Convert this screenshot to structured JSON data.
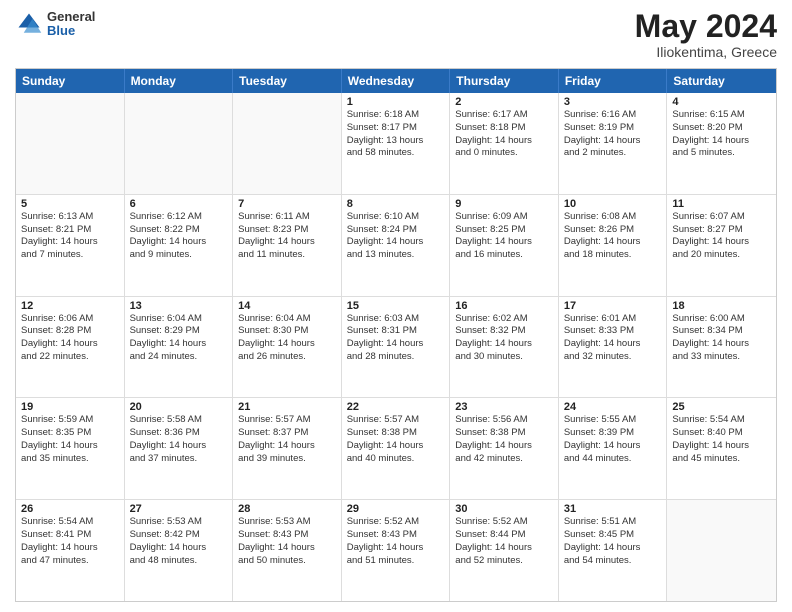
{
  "header": {
    "logo_general": "General",
    "logo_blue": "Blue",
    "title": "May 2024",
    "location": "Iliokentima, Greece"
  },
  "weekdays": [
    "Sunday",
    "Monday",
    "Tuesday",
    "Wednesday",
    "Thursday",
    "Friday",
    "Saturday"
  ],
  "weeks": [
    [
      {
        "day": "",
        "info": ""
      },
      {
        "day": "",
        "info": ""
      },
      {
        "day": "",
        "info": ""
      },
      {
        "day": "1",
        "info": "Sunrise: 6:18 AM\nSunset: 8:17 PM\nDaylight: 13 hours\nand 58 minutes."
      },
      {
        "day": "2",
        "info": "Sunrise: 6:17 AM\nSunset: 8:18 PM\nDaylight: 14 hours\nand 0 minutes."
      },
      {
        "day": "3",
        "info": "Sunrise: 6:16 AM\nSunset: 8:19 PM\nDaylight: 14 hours\nand 2 minutes."
      },
      {
        "day": "4",
        "info": "Sunrise: 6:15 AM\nSunset: 8:20 PM\nDaylight: 14 hours\nand 5 minutes."
      }
    ],
    [
      {
        "day": "5",
        "info": "Sunrise: 6:13 AM\nSunset: 8:21 PM\nDaylight: 14 hours\nand 7 minutes."
      },
      {
        "day": "6",
        "info": "Sunrise: 6:12 AM\nSunset: 8:22 PM\nDaylight: 14 hours\nand 9 minutes."
      },
      {
        "day": "7",
        "info": "Sunrise: 6:11 AM\nSunset: 8:23 PM\nDaylight: 14 hours\nand 11 minutes."
      },
      {
        "day": "8",
        "info": "Sunrise: 6:10 AM\nSunset: 8:24 PM\nDaylight: 14 hours\nand 13 minutes."
      },
      {
        "day": "9",
        "info": "Sunrise: 6:09 AM\nSunset: 8:25 PM\nDaylight: 14 hours\nand 16 minutes."
      },
      {
        "day": "10",
        "info": "Sunrise: 6:08 AM\nSunset: 8:26 PM\nDaylight: 14 hours\nand 18 minutes."
      },
      {
        "day": "11",
        "info": "Sunrise: 6:07 AM\nSunset: 8:27 PM\nDaylight: 14 hours\nand 20 minutes."
      }
    ],
    [
      {
        "day": "12",
        "info": "Sunrise: 6:06 AM\nSunset: 8:28 PM\nDaylight: 14 hours\nand 22 minutes."
      },
      {
        "day": "13",
        "info": "Sunrise: 6:04 AM\nSunset: 8:29 PM\nDaylight: 14 hours\nand 24 minutes."
      },
      {
        "day": "14",
        "info": "Sunrise: 6:04 AM\nSunset: 8:30 PM\nDaylight: 14 hours\nand 26 minutes."
      },
      {
        "day": "15",
        "info": "Sunrise: 6:03 AM\nSunset: 8:31 PM\nDaylight: 14 hours\nand 28 minutes."
      },
      {
        "day": "16",
        "info": "Sunrise: 6:02 AM\nSunset: 8:32 PM\nDaylight: 14 hours\nand 30 minutes."
      },
      {
        "day": "17",
        "info": "Sunrise: 6:01 AM\nSunset: 8:33 PM\nDaylight: 14 hours\nand 32 minutes."
      },
      {
        "day": "18",
        "info": "Sunrise: 6:00 AM\nSunset: 8:34 PM\nDaylight: 14 hours\nand 33 minutes."
      }
    ],
    [
      {
        "day": "19",
        "info": "Sunrise: 5:59 AM\nSunset: 8:35 PM\nDaylight: 14 hours\nand 35 minutes."
      },
      {
        "day": "20",
        "info": "Sunrise: 5:58 AM\nSunset: 8:36 PM\nDaylight: 14 hours\nand 37 minutes."
      },
      {
        "day": "21",
        "info": "Sunrise: 5:57 AM\nSunset: 8:37 PM\nDaylight: 14 hours\nand 39 minutes."
      },
      {
        "day": "22",
        "info": "Sunrise: 5:57 AM\nSunset: 8:38 PM\nDaylight: 14 hours\nand 40 minutes."
      },
      {
        "day": "23",
        "info": "Sunrise: 5:56 AM\nSunset: 8:38 PM\nDaylight: 14 hours\nand 42 minutes."
      },
      {
        "day": "24",
        "info": "Sunrise: 5:55 AM\nSunset: 8:39 PM\nDaylight: 14 hours\nand 44 minutes."
      },
      {
        "day": "25",
        "info": "Sunrise: 5:54 AM\nSunset: 8:40 PM\nDaylight: 14 hours\nand 45 minutes."
      }
    ],
    [
      {
        "day": "26",
        "info": "Sunrise: 5:54 AM\nSunset: 8:41 PM\nDaylight: 14 hours\nand 47 minutes."
      },
      {
        "day": "27",
        "info": "Sunrise: 5:53 AM\nSunset: 8:42 PM\nDaylight: 14 hours\nand 48 minutes."
      },
      {
        "day": "28",
        "info": "Sunrise: 5:53 AM\nSunset: 8:43 PM\nDaylight: 14 hours\nand 50 minutes."
      },
      {
        "day": "29",
        "info": "Sunrise: 5:52 AM\nSunset: 8:43 PM\nDaylight: 14 hours\nand 51 minutes."
      },
      {
        "day": "30",
        "info": "Sunrise: 5:52 AM\nSunset: 8:44 PM\nDaylight: 14 hours\nand 52 minutes."
      },
      {
        "day": "31",
        "info": "Sunrise: 5:51 AM\nSunset: 8:45 PM\nDaylight: 14 hours\nand 54 minutes."
      },
      {
        "day": "",
        "info": ""
      }
    ]
  ]
}
